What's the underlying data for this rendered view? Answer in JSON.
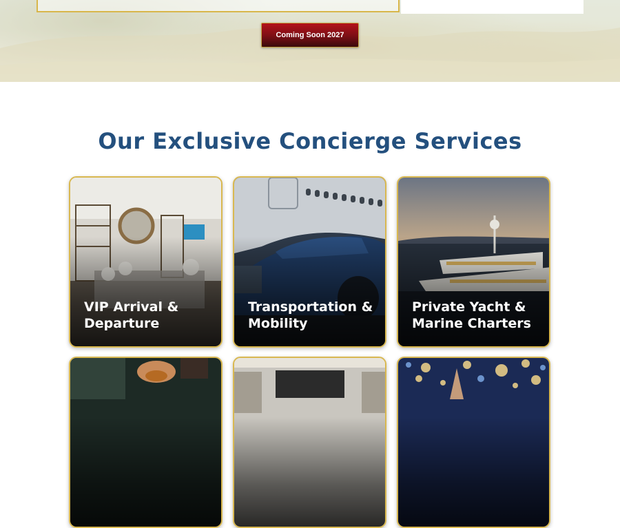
{
  "hero": {
    "cta_label": "Coming Soon 2027"
  },
  "services": {
    "title": "Our Exclusive Concierge Services",
    "cards": [
      {
        "title": "VIP Arrival & Departure"
      },
      {
        "title": "Transportation & Mobility"
      },
      {
        "title": "Private Yacht & Marine Charters"
      },
      {
        "title": ""
      },
      {
        "title": ""
      },
      {
        "title": ""
      }
    ]
  },
  "colors": {
    "heading": "#24507e",
    "accent_gold": "#d9b850",
    "cta_red": "#8c1117"
  }
}
